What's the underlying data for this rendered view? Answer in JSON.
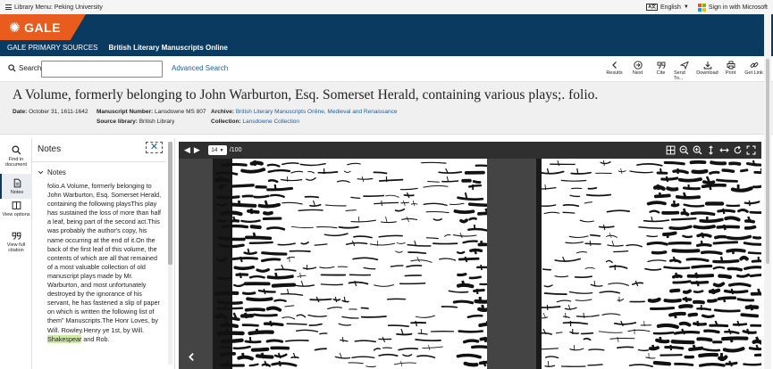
{
  "topbar": {
    "library_menu": "Library Menu: Peking University",
    "language": "English",
    "language_icon": "language-icon",
    "signin": "Sign in with Microsoft"
  },
  "header": {
    "logo": "GALE",
    "primary_sources": "GALE PRIMARY SOURCES",
    "collection": "British Literary Manuscripts Online"
  },
  "search": {
    "label": "Search:",
    "value": "",
    "advanced": "Advanced Search"
  },
  "toolbar": [
    {
      "label": "Results",
      "icon": "chevron-left-icon"
    },
    {
      "label": "Next",
      "icon": "next-circle-icon"
    },
    {
      "label": "Cite",
      "icon": "quote-icon"
    },
    {
      "label": "Send To...",
      "icon": "send-icon"
    },
    {
      "label": "Download",
      "icon": "download-icon"
    },
    {
      "label": "Print",
      "icon": "print-icon"
    },
    {
      "label": "Get Link",
      "icon": "link-icon"
    }
  ],
  "document": {
    "title": "A Volume, formerly belonging to John Warburton, Esq. Somerset Herald, containing various plays;. folio.",
    "date_label": "Date:",
    "date": "October 31, 1611-1642",
    "manuscript_label": "Manuscript Number:",
    "manuscript": "Lansdowne MS 807",
    "source_label": "Source library:",
    "source": "British Library",
    "archive_label": "Archive:",
    "archive": "British Literary Manuscripts Online, Medieval and Renaissance",
    "collection_label": "Collection:",
    "collection": "Lansdowne Collection"
  },
  "rail": [
    {
      "label": "Find in document",
      "icon": "search-icon"
    },
    {
      "label": "Notes",
      "icon": "document-icon",
      "active": true
    },
    {
      "label": "View options",
      "icon": "columns-icon"
    },
    {
      "label": "View full citation",
      "icon": "quote-icon"
    }
  ],
  "notes": {
    "heading": "Notes",
    "close": "✕",
    "section": "Notes",
    "text_before": "folio.A Volume, formerly belonging to John Warburton, Esq. Somerset Herald, containing the following playsThis play has sustained the loss of more than half a leaf, being part of the second act.This was probably the author's copy, his name occurring at the end of it.On the back of the first leaf of this volume, the contents of which are all that remained of a most valuable collection of old manuscript plays made by Mr. Warburton, and most unfortunately destroyed by the ignorance of his servant, he has fastened a slip of paper on which is written the following list of them\" Manuscripts.The Honr Loves, by Will. Rowley.Henry ye 1st, by Will.",
    "highlight": "Shakespear",
    "text_after": " and Rob."
  },
  "viewer": {
    "page_current": "14",
    "page_total": "/100",
    "tools": [
      "grid-icon",
      "zoom-out-icon",
      "zoom-in-icon",
      "fit-height-icon",
      "fit-width-icon",
      "rotate-icon",
      "fullscreen-icon"
    ]
  },
  "colors": {
    "header_bg": "#0b3a60",
    "logo_bg": "#e85d1d",
    "link": "#1d5c9a",
    "title_bg": "#f0f0f0",
    "viewer_bar": "#2f2f2f",
    "highlight": "#cfe8a4"
  }
}
